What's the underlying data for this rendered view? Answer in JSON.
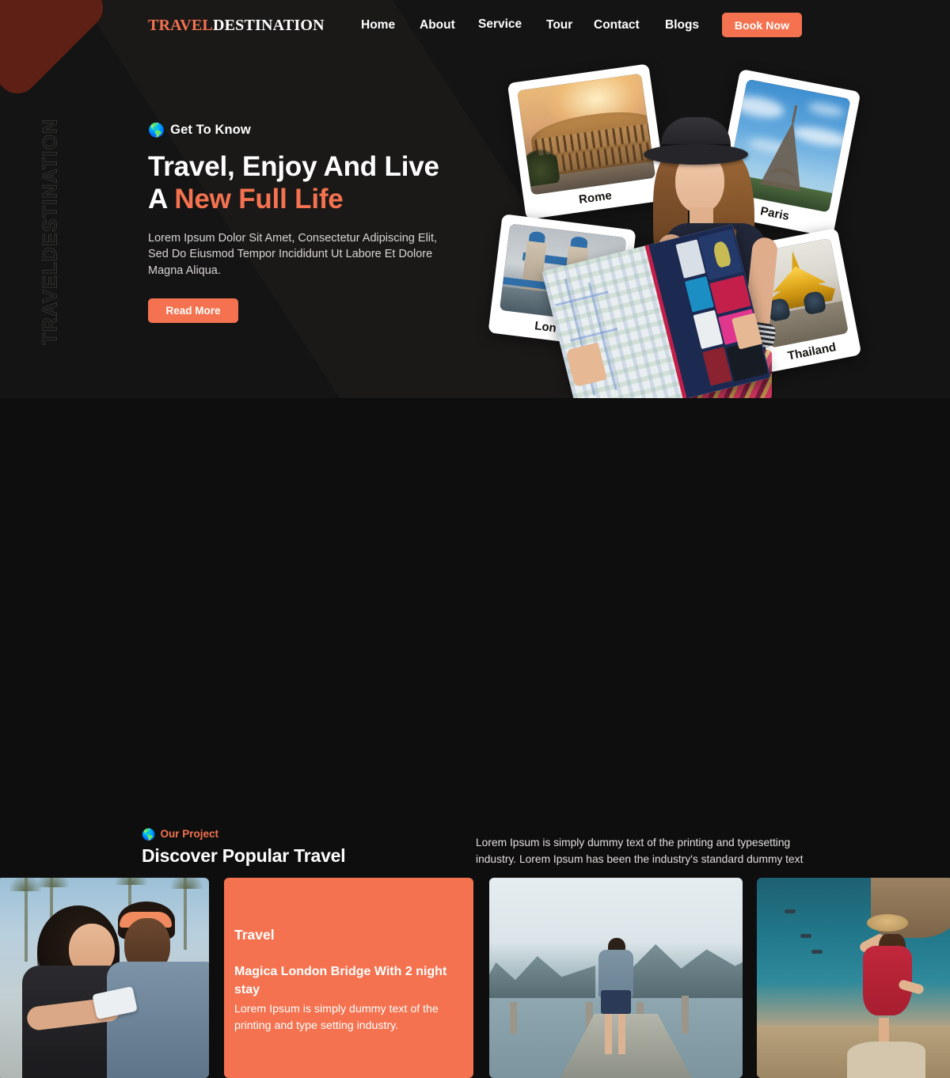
{
  "brand": {
    "logo_primary": "TRAVEL",
    "logo_secondary": "DESTINATION",
    "accent_color": "#f4724f",
    "vertical_watermark": "TRAVELDESTINATION"
  },
  "nav": {
    "items": [
      {
        "label": "Home"
      },
      {
        "label": "About"
      },
      {
        "label": "Service"
      },
      {
        "label": "Tour"
      },
      {
        "label": "Contact"
      },
      {
        "label": "Blogs"
      }
    ],
    "cta_label": "Book Now"
  },
  "hero": {
    "eyebrow": "Get To Know",
    "eyebrow_icon": "globe-icon",
    "title_line1": "Travel, Enjoy And Live",
    "title_line2_plain": "A ",
    "title_line2_accent": "New Full Life",
    "paragraph": "Lorem Ipsum Dolor Sit Amet, Consectetur Adipiscing Elit, Sed Do Eiusmod Tempor Incididunt Ut Labore Et Dolore Magna Aliqua.",
    "button_label": "Read More",
    "postcards": [
      {
        "caption": "Rome",
        "subject": "colosseum-photo"
      },
      {
        "caption": "Paris",
        "subject": "eiffel-tower-photo"
      },
      {
        "caption": "London",
        "subject": "tower-bridge-photo"
      },
      {
        "caption": "Thailand",
        "subject": "golden-temple-photo"
      }
    ],
    "foreground_subject": "woman-holding-tourist-map"
  },
  "projects": {
    "eyebrow": "Our Project",
    "eyebrow_icon": "globe-icon",
    "title": "Discover Popular Travel",
    "paragraph": "Lorem Ipsum is simply dummy text of the printing and typesetting industry. Lorem Ipsum has been the industry's standard dummy text",
    "cards": [
      {
        "type": "image",
        "subject": "couple-taking-selfie-photo"
      },
      {
        "type": "text",
        "background_color": "#f4724f",
        "category": "Travel",
        "title": "Magica London Bridge With 2 night stay",
        "description": "Lorem Ipsum is simply dummy text of the printing and type setting industry."
      },
      {
        "type": "image",
        "subject": "man-on-pier-mountains-photo"
      },
      {
        "type": "image",
        "subject": "woman-red-dress-cliff-photo"
      }
    ]
  }
}
